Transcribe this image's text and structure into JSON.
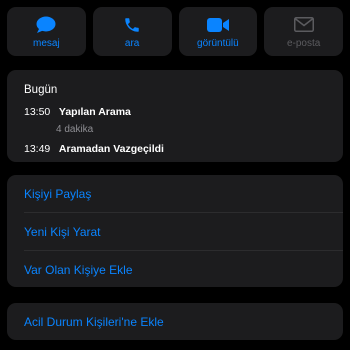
{
  "actions": [
    {
      "label": "mesaj",
      "icon": "message-icon"
    },
    {
      "label": "ara",
      "icon": "phone-icon"
    },
    {
      "label": "görüntülü",
      "icon": "video-icon"
    },
    {
      "label": "e-posta",
      "icon": "mail-icon"
    }
  ],
  "recent": {
    "heading": "Bugün",
    "calls": [
      {
        "time": "13:50",
        "type": "Yapılan Arama",
        "duration": "4 dakika"
      },
      {
        "time": "13:49",
        "type": "Aramadan Vazgeçildi"
      }
    ]
  },
  "options": [
    "Kişiyi Paylaş",
    "Yeni Kişi Yarat",
    "Var Olan Kişiye Ekle"
  ],
  "emergency": "Acil Durum Kişileri'ne Ekle",
  "colors": {
    "accent": "#0a84ff",
    "card": "#1c1c1e",
    "disabled": "#5b5b5f"
  }
}
